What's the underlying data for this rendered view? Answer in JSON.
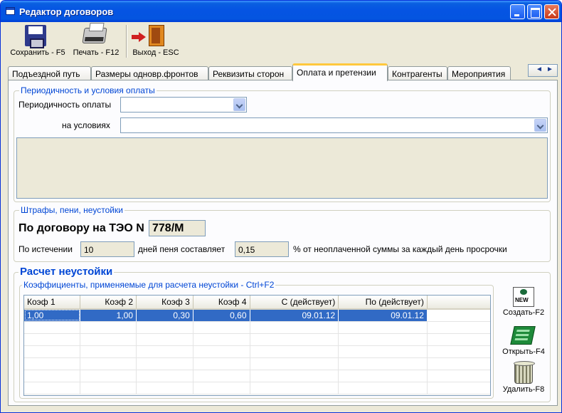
{
  "window": {
    "title": "Редактор договоров"
  },
  "toolbar": {
    "save_label": "Сохранить - F5",
    "print_label": "Печать - F12",
    "exit_label": "Выход - ESC"
  },
  "tabs": [
    {
      "label": "Подъездной путь"
    },
    {
      "label": "Размеры одновр.фронтов"
    },
    {
      "label": "Реквизиты сторон"
    },
    {
      "label": "Оплата и претензии",
      "active": true
    },
    {
      "label": "Контрагенты"
    },
    {
      "label": "Мероприятия"
    }
  ],
  "payment": {
    "group_title": "Периодичность и условия оплаты",
    "periodicity_label": "Периодичность оплаты",
    "periodicity_value": "",
    "conditions_label": "на условиях",
    "conditions_value": ""
  },
  "penalties": {
    "group_title": "Штрафы, пени, неустойки",
    "contract_label": "По договору на ТЭО N",
    "contract_number": "778/М",
    "after_label": "По истечении",
    "days_value": "10",
    "rate_label": "дней пеня составляет",
    "rate_value": "0,15",
    "suffix_label": "% от неоплаченной суммы за каждый день просрочки"
  },
  "calc": {
    "title": "Расчет неустойки",
    "coef_group_title": "Коэффициенты, применяемые для расчета неустойки - Ctrl+F2",
    "columns": [
      "Коэф 1",
      "Коэф 2",
      "Коэф 3",
      "Коэф 4",
      "С (действует)",
      "По (действует)"
    ],
    "rows": [
      [
        "1,00",
        "1,00",
        "0,30",
        "0,60",
        "09.01.12",
        "09.01.12"
      ]
    ],
    "create_label": "Создать-F2",
    "open_label": "Открыть-F4",
    "delete_label": "Удалить-F8",
    "new_badge": "NEW"
  }
}
